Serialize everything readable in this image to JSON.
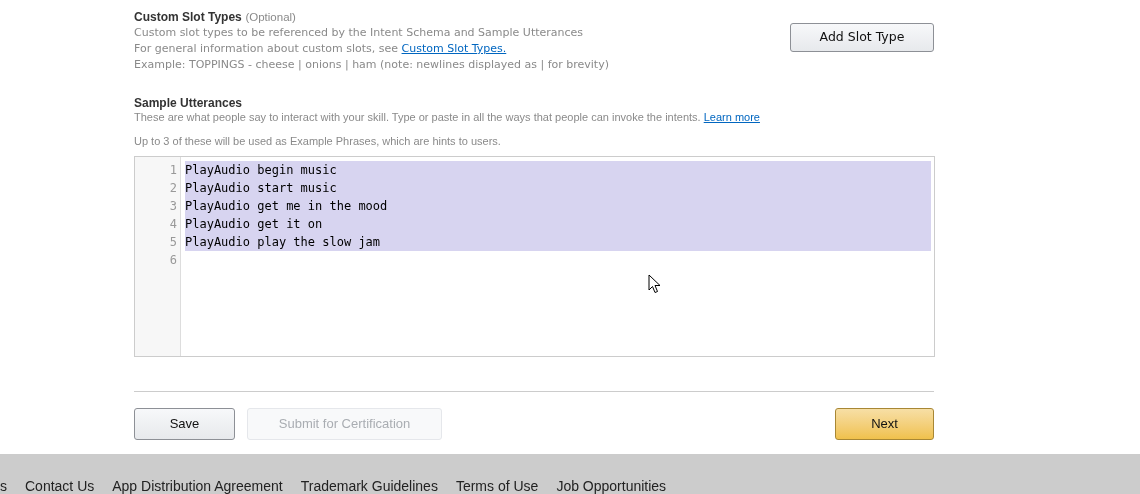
{
  "slot_types": {
    "title": "Custom Slot Types",
    "optional": "(Optional)",
    "description": "Custom slot types to be referenced by the Intent Schema and Sample Utterances",
    "info": "For general information about custom slots, see",
    "info_link": "Custom Slot Types.",
    "example": "Example: TOPPINGS - cheese | onions | ham (note: newlines displayed as | for brevity)",
    "add_button": "Add Slot Type"
  },
  "utterances": {
    "title": "Sample Utterances",
    "description": "These are what people say to interact with your skill. Type or paste in all the ways that people can invoke the intents.",
    "learn_more": "Learn more",
    "hint": "Up to 3 of these will be used as Example Phrases, which are hints to users.",
    "lines": [
      {
        "number": "1",
        "text": "PlayAudio begin music",
        "selected": true
      },
      {
        "number": "2",
        "text": "PlayAudio start music",
        "selected": true
      },
      {
        "number": "3",
        "text": "PlayAudio get me in the mood",
        "selected": true
      },
      {
        "number": "4",
        "text": "PlayAudio get it on",
        "selected": true
      },
      {
        "number": "5",
        "text": "PlayAudio play the slow jam",
        "selected": true
      },
      {
        "number": "6"
      }
    ]
  },
  "actions": [
    {
      "label": "Save",
      "kind": "default",
      "disabled": false
    },
    {
      "label": "Submit for Certification",
      "kind": "default",
      "disabled": true
    },
    {
      "label": "Next",
      "kind": "primary",
      "disabled": false
    }
  ],
  "footer": [
    "s",
    "Contact Us",
    "App Distribution Agreement",
    "Trademark Guidelines",
    "Terms of Use",
    "Job Opportunities"
  ]
}
